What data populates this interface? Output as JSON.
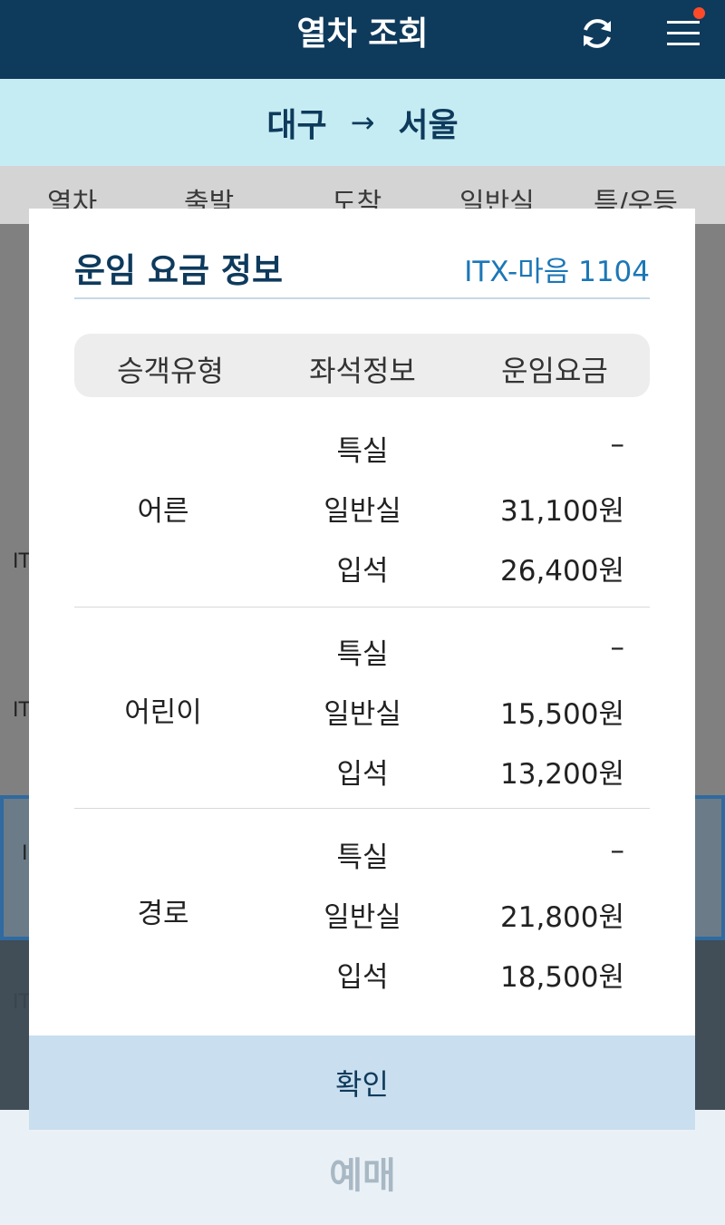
{
  "header": {
    "title": "열차 조회",
    "refresh_icon": "refresh-icon",
    "menu_icon": "hamburger-menu-icon"
  },
  "route": {
    "from": "대구",
    "arrow": "→",
    "to": "서울"
  },
  "columns": [
    "열차",
    "출발",
    "도착",
    "일반실",
    "특/우등"
  ],
  "background_rows": [
    "IT",
    "IT",
    "I",
    "IT"
  ],
  "modal": {
    "title": "운임 요금 정보",
    "train": "ITX-마음 1104",
    "table_headers": [
      "승객유형",
      "좌석정보",
      "운임요금"
    ],
    "groups": [
      {
        "type": "어른",
        "rows": [
          {
            "seat": "특실",
            "fare": "–"
          },
          {
            "seat": "일반실",
            "fare": "31,100원"
          },
          {
            "seat": "입석",
            "fare": "26,400원"
          }
        ]
      },
      {
        "type": "어린이",
        "rows": [
          {
            "seat": "특실",
            "fare": "–"
          },
          {
            "seat": "일반실",
            "fare": "15,500원"
          },
          {
            "seat": "입석",
            "fare": "13,200원"
          }
        ]
      },
      {
        "type": "경로",
        "rows": [
          {
            "seat": "특실",
            "fare": "–"
          },
          {
            "seat": "일반실",
            "fare": "21,800원"
          },
          {
            "seat": "입석",
            "fare": "18,500원"
          }
        ]
      }
    ],
    "confirm_label": "확인"
  },
  "bottom": {
    "book_label": "예매"
  },
  "colors": {
    "header_bg": "#0e3a5c",
    "route_bg": "#c6ecf3",
    "accent_text": "#1b77b7",
    "confirm_bg": "#c9deee",
    "notification_dot": "#ff4a2a"
  }
}
